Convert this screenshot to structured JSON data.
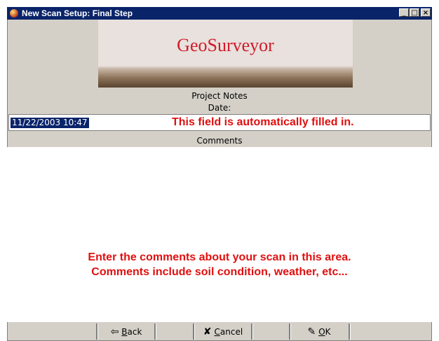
{
  "window": {
    "title": "New Scan Setup: Final Step",
    "controls": {
      "minimize": "_",
      "maximize": "□",
      "close": "×"
    }
  },
  "banner": {
    "brand": "GeoSurveyor"
  },
  "labels": {
    "project_notes": "Project Notes",
    "date": "Date:",
    "comments": "Comments"
  },
  "date_field": {
    "value": "11/22/2003 10:47",
    "note": "This field is automatically filled in."
  },
  "comments_area": {
    "instruction_line1": "Enter the comments about your scan in this area.",
    "instruction_line2": "Comments include soil condition, weather, etc..."
  },
  "buttons": {
    "back": {
      "label_first": "B",
      "label_rest": "ack",
      "icon": "arrow-left-icon"
    },
    "cancel": {
      "label_first": "C",
      "label_rest": "ancel",
      "icon": "x-icon"
    },
    "ok": {
      "label_first": "O",
      "label_rest": "K",
      "icon": "checkmark-icon"
    }
  },
  "colors": {
    "titlebar": "#0a246a",
    "annotation_red": "#e01010",
    "brand_red": "#d11a2a",
    "face": "#d4d0c8"
  }
}
